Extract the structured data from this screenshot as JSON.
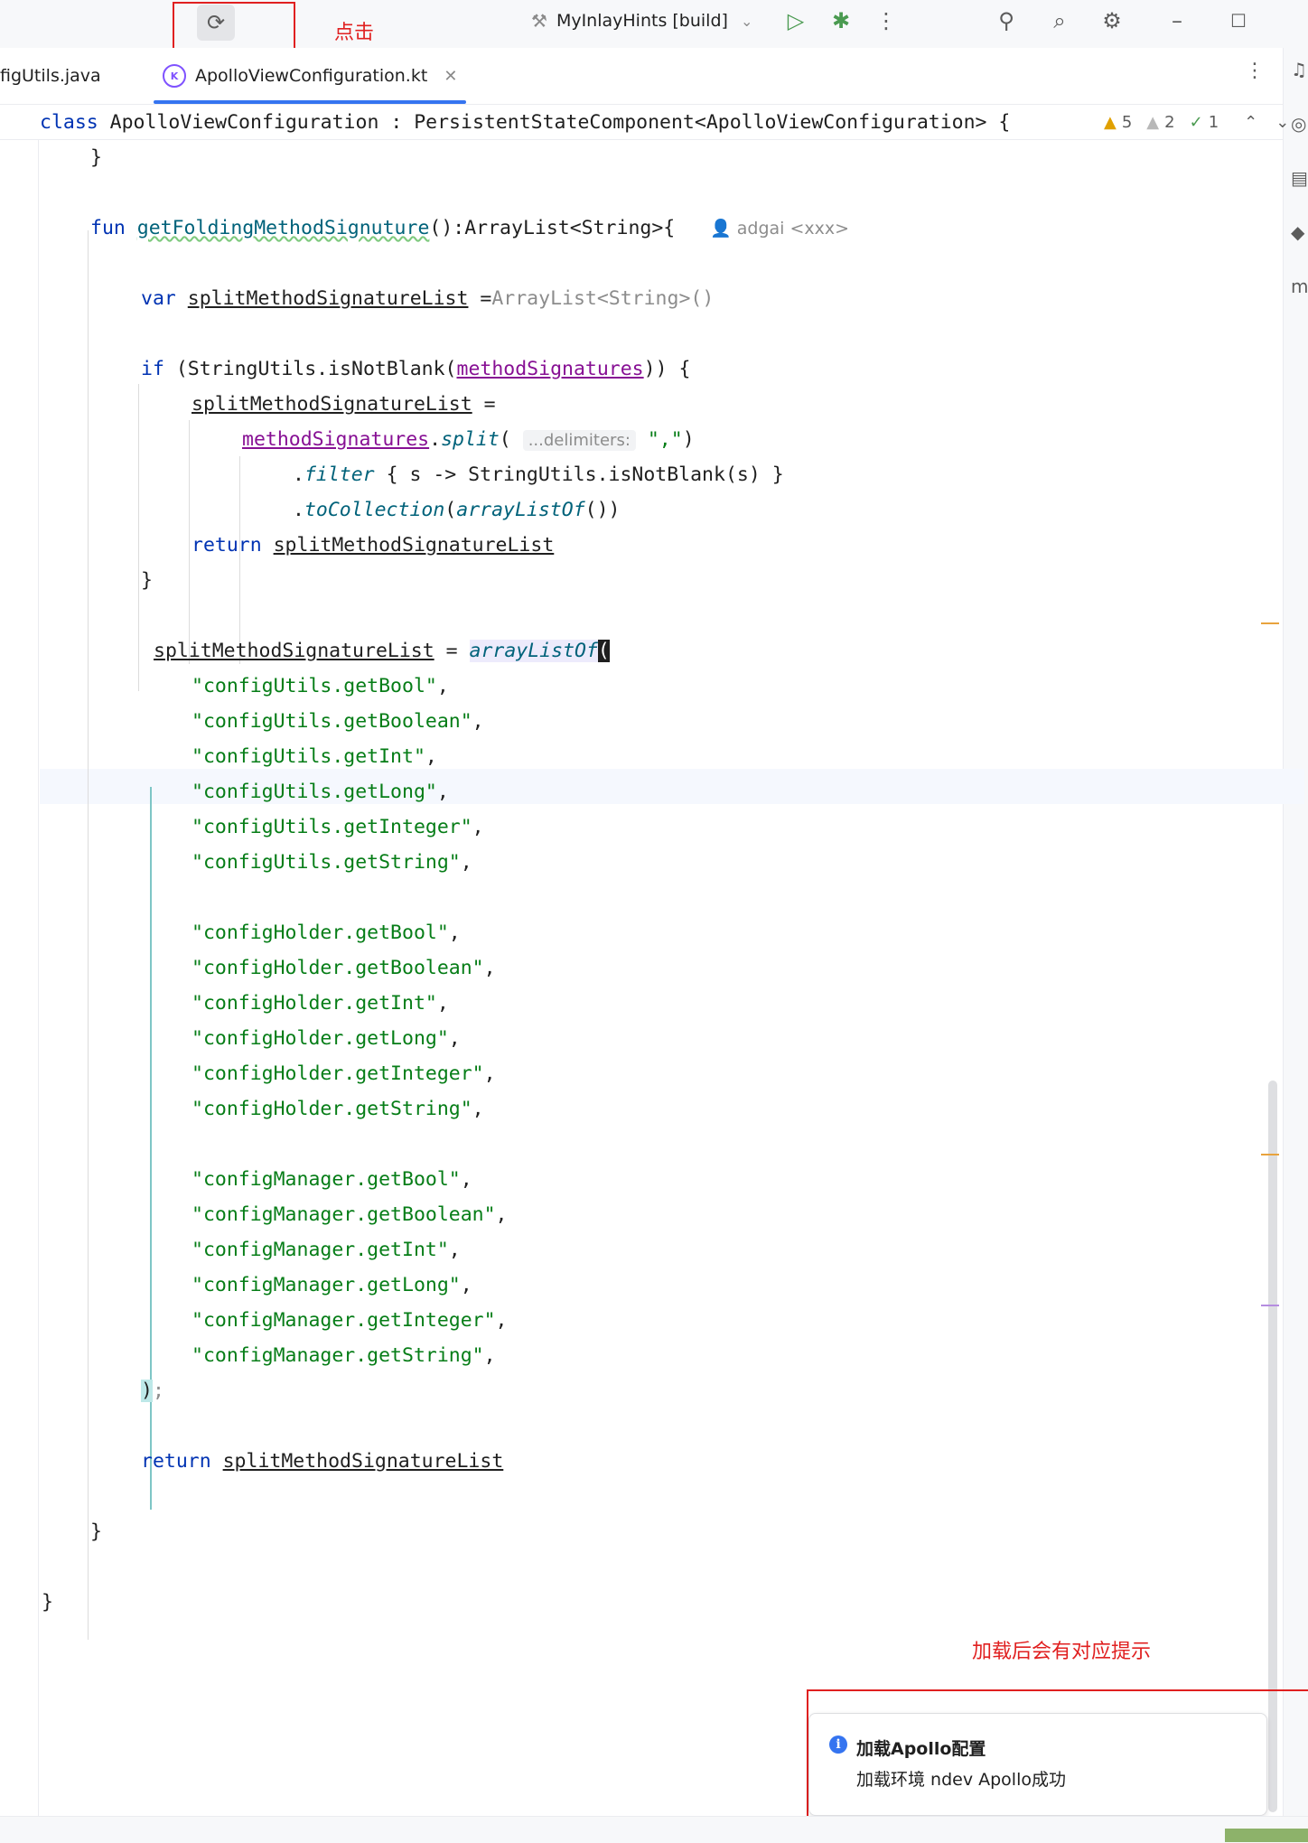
{
  "titlebar": {
    "run_config": "MyInlayHints [build]",
    "annotation_click": "点击",
    "icons": [
      "reload-icon",
      "run-config-icon",
      "chevron-down-icon",
      "run-icon",
      "debug-icon",
      "more-vertical-icon",
      "add-user-icon",
      "search-icon",
      "gear-icon",
      "minimize-icon",
      "maximize-icon"
    ]
  },
  "tabs": [
    {
      "label": "figUtils.java",
      "active": false
    },
    {
      "label": "ApolloViewConfiguration.kt",
      "active": true
    }
  ],
  "sticky": {
    "kw": "class ",
    "name": "ApolloViewConfiguration",
    "rest": " : PersistentStateComponent<ApolloViewConfiguration> {"
  },
  "inspections": {
    "warnings": "5",
    "weak_warnings": "2",
    "ok": "1"
  },
  "code": {
    "close_brace": "}",
    "fun_kw": "fun ",
    "fun_name": "getFoldingMethodSignuture",
    "fun_sig": "():ArrayList<String>{",
    "author": "adgai <xxx>",
    "var_kw": "var ",
    "list_var": "splitMethodSignatureList",
    "assign_space": " =",
    "assign_spaced": " = ",
    "arraylist_ctor": "ArrayList<String>()",
    "if_kw": "if ",
    "if_open": "(StringUtils.isNotBlank(",
    "method_sigs": "methodSignatures",
    "if_close": ")) {",
    "dot": ".",
    "split_fn": "split",
    "paren_open": "(",
    "param_hint": "...delimiters:",
    "comma_str": "\",\"",
    "paren_close": ")",
    "filter_fn": "filter",
    "filter_body": " { s -> StringUtils.isNotBlank(s) }",
    "tocollection_fn": "toCollection",
    "arraylistof_fn": "arrayListOf",
    "empty_call": "())",
    "return_kw": "return ",
    "close_paren": ")",
    "semicolon": ";",
    "comma": ",",
    "strings": [
      "\"configUtils.getBool\"",
      "\"configUtils.getBoolean\"",
      "\"configUtils.getInt\"",
      "\"configUtils.getLong\"",
      "\"configUtils.getInteger\"",
      "\"configUtils.getString\"",
      "",
      "\"configHolder.getBool\"",
      "\"configHolder.getBoolean\"",
      "\"configHolder.getInt\"",
      "\"configHolder.getLong\"",
      "\"configHolder.getInteger\"",
      "\"configHolder.getString\"",
      "",
      "\"configManager.getBool\"",
      "\"configManager.getBoolean\"",
      "\"configManager.getInt\"",
      "\"configManager.getLong\"",
      "\"configManager.getInteger\"",
      "\"configManager.getString\""
    ]
  },
  "annotation_hint": "加载后会有对应提示",
  "notification": {
    "title": "加载Apollo配置",
    "body": "加载环境 ndev Apollo成功"
  },
  "colors": {
    "keyword": "#0033b3",
    "string": "#067d17",
    "function": "#00627a",
    "property": "#871094",
    "annotation_red": "#e02020",
    "accent": "#3574f0"
  }
}
